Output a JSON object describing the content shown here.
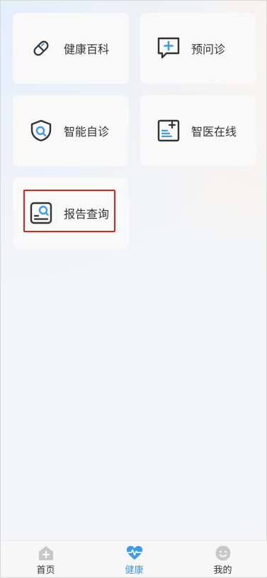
{
  "cards": [
    {
      "label": "健康百科",
      "icon": "pill-icon"
    },
    {
      "label": "预问诊",
      "icon": "chat-plus-icon"
    },
    {
      "label": "智能自诊",
      "icon": "shield-search-icon"
    },
    {
      "label": "智医在线",
      "icon": "document-plus-icon"
    },
    {
      "label": "报告查询",
      "icon": "report-search-icon"
    }
  ],
  "highlighted_card": "报告查询",
  "tabbar": {
    "items": [
      {
        "label": "首页",
        "icon": "home-icon",
        "active": false
      },
      {
        "label": "健康",
        "icon": "heart-pulse-icon",
        "active": true
      },
      {
        "label": "我的",
        "icon": "smiley-icon",
        "active": false
      }
    ]
  },
  "colors": {
    "accent": "#3d9be9",
    "icon_dark": "#333333",
    "highlight": "#e0201c"
  }
}
